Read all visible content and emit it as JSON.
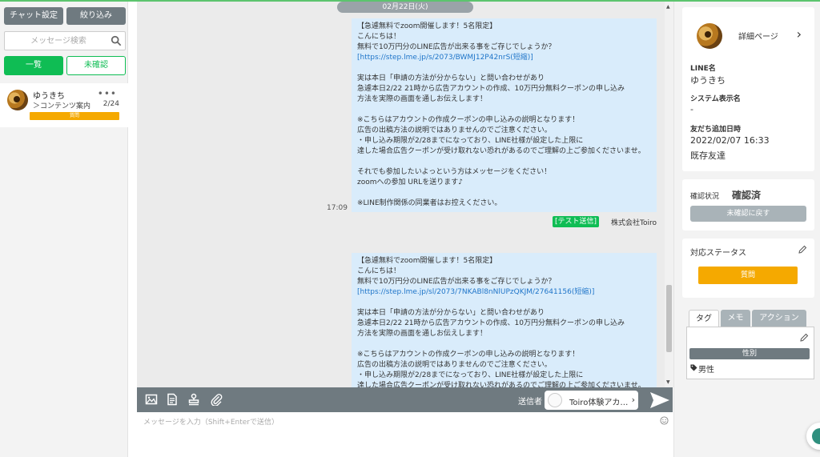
{
  "sidebar": {
    "chat_settings_label": "チャット設定",
    "filter_label": "絞り込み",
    "search_placeholder": "メッセージ検索",
    "filter_all_label": "一覧",
    "filter_unread_label": "未確認",
    "chat_list": [
      {
        "name": "ゆうきち",
        "subtitle": "＞コンテンツ案内",
        "count": "2/24",
        "menu": "•••",
        "badge": "質問"
      }
    ]
  },
  "chat": {
    "date": "02月22日(火)",
    "messages": [
      {
        "time": "17:09",
        "sender_badge": "[テスト送信]",
        "sender_name": "株式会社Toiro",
        "lines": [
          "【急遽無料でzoom開催します！5名限定】",
          "こんにちは！",
          "無料で10万円分のLINE広告が出来る事をご存じでしょうか？",
          "[https://step.lme.jp/s/2073/BWMJ12P42nrS(短縮)]",
          "",
          "実は本日「申請の方法が分からない」と問い合わせがあり",
          "急遽本日2/22 21時から広告アカウントの作成、10万円分無料クーポンの申し込み",
          "方法を実際の画面を通しお伝えします！",
          "",
          "※こちらはアカウントの作成クーポンの申し込みの説明となります！",
          "広告の出稿方法の説明ではありませんのでご注意ください。",
          "・申し込み期限が2/28までになっており、LINE社様が設定した上限に",
          "達した場合広告クーポンが受け取れない恐れがあるのでご理解の上ご参加くださいませ。",
          "",
          "それでも参加したいよっという方はメッセージをください！",
          "zoomへの参加 URLを送ります♪",
          "",
          "※LINE制作関係の同業者はお控えください。"
        ]
      },
      {
        "lines": [
          "【急遽無料でzoom開催します！5名限定】",
          "こんにちは！",
          "無料で10万円分のLINE広告が出来る事をご存じでしょうか？",
          "[https://step.lme.jp/sl/2073/7NKABl8nNlUPzQKJM/27641156(短縮)]",
          "",
          "実は本日「申請の方法が分からない」と問い合わせがあり",
          "急遽本日2/22 21時から広告アカウントの作成、10万円分無料クーポンの申し込み",
          "方法を実際の画面を通しお伝えします！",
          "",
          "※こちらはアカウントの作成クーポンの申し込みの説明となります！",
          "広告の出稿方法の説明ではありませんのでご注意ください。",
          "・申し込み期限が2/28までになっており、LINE社様が設定した上限に",
          "達した場合広告クーポンが受け取れない恐れがあるのでご理解の上ご参加くださいませ。"
        ]
      }
    ]
  },
  "composer": {
    "sender_label": "送信者",
    "sender_value": "Toiro体験アカ…",
    "placeholder": "メッセージを入力（Shift+Enterで送信）"
  },
  "profile": {
    "detail_label": "詳細ページ",
    "line_name_label": "LINE名",
    "line_name": "ゆうきち",
    "system_name_label": "システム表示名",
    "system_name": "-",
    "added_label": "友だち追加日時",
    "added_date": "2022/02/07 16:33",
    "friend_status": "既存友達",
    "confirm_label": "確認状況",
    "confirm_value": "確認済",
    "unconfirm_button": "未確認に戻す",
    "response_status_label": "対応ステータス",
    "response_status_value": "質問",
    "tabs": [
      "タグ",
      "メモ",
      "アクション"
    ],
    "tag_category": "性別",
    "tag_item": "男性"
  },
  "colors": {
    "accent_green": "#0fbd54",
    "toolbar_gray": "#6f7a80",
    "status_orange": "#f5a900",
    "bubble_blue": "#d9ecfb"
  }
}
